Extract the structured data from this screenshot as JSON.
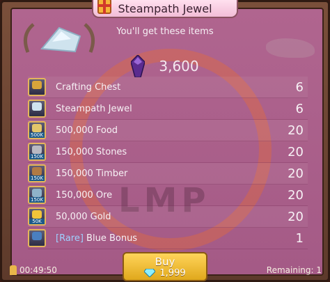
{
  "title": "Steampath Jewel",
  "subtitle": "You'll get these items",
  "total_gems": "3,600",
  "items": [
    {
      "name": "Crafting Chest",
      "qty": "6",
      "tag": "",
      "icon": "chest-icon"
    },
    {
      "name": "Steampath Jewel",
      "qty": "6",
      "tag": "",
      "icon": "jewel-icon"
    },
    {
      "name": "500,000 Food",
      "qty": "20",
      "tag": "500K",
      "icon": "wheat-icon"
    },
    {
      "name": "150,000 Stones",
      "qty": "20",
      "tag": "150K",
      "icon": "stone-icon"
    },
    {
      "name": "150,000 Timber",
      "qty": "20",
      "tag": "150K",
      "icon": "timber-icon"
    },
    {
      "name": "150,000 Ore",
      "qty": "20",
      "tag": "150K",
      "icon": "ore-icon"
    },
    {
      "name": "50,000 Gold",
      "qty": "20",
      "tag": "50K",
      "icon": "gold-icon"
    },
    {
      "name_prefix": "[Rare]",
      "name": " Blue Bonus",
      "qty": "1",
      "tag": "",
      "icon": "bonus-chest-icon"
    }
  ],
  "timer": "00:49:50",
  "buy": {
    "label": "Buy",
    "price": "1,999"
  },
  "remaining": "Remaining: 1",
  "watermark": "LMP",
  "colors": {
    "panel": "#a45a86",
    "accent": "#e0a81c",
    "rare": "#9fd0ff"
  }
}
